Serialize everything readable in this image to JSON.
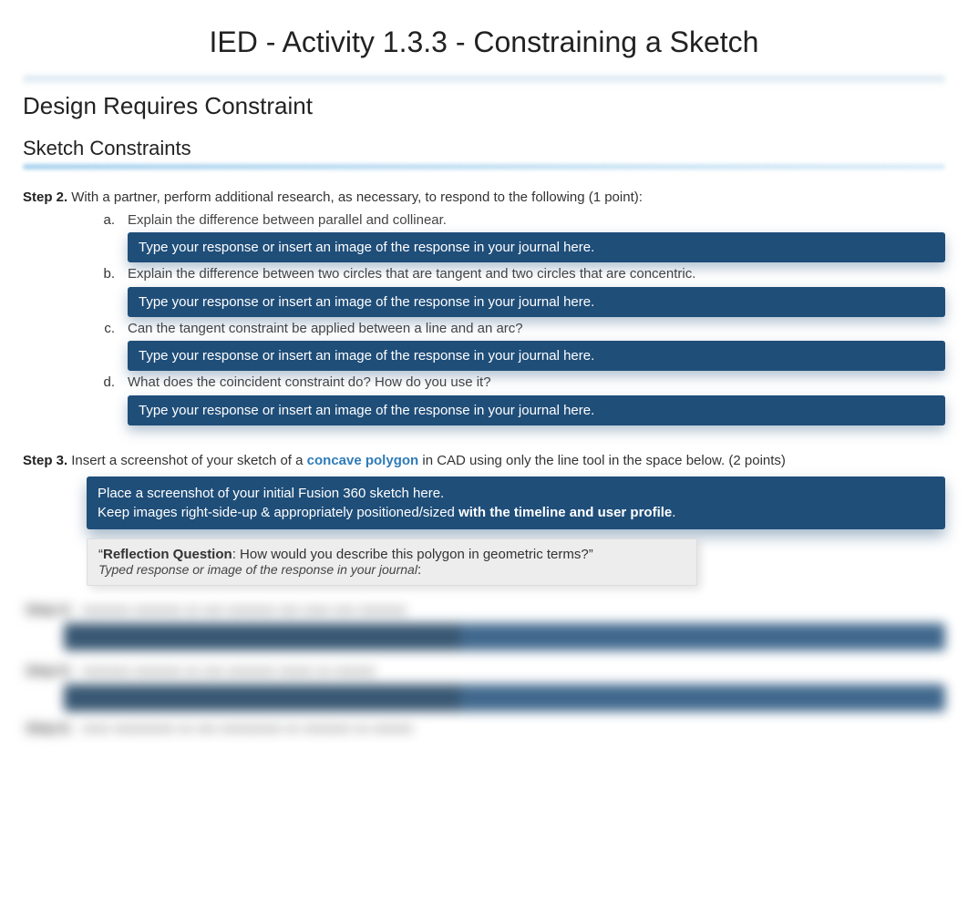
{
  "title": "IED - Activity 1.3.3 - Constraining a Sketch",
  "heading1": "Design Requires Constraint",
  "heading2": "Sketch Constraints",
  "step2": {
    "label": "Step 2.",
    "text": "With a partner, perform additional research, as necessary, to respond to the following (1 point):",
    "items": [
      {
        "marker": "a.",
        "text": "Explain the difference between parallel and collinear."
      },
      {
        "marker": "b.",
        "text": "Explain the difference between two circles that are tangent and two circles that are concentric."
      },
      {
        "marker": "c.",
        "text": "Can the tangent constraint be applied between a line and an arc?"
      },
      {
        "marker": "d.",
        "text": "What does the coincident constraint do? How do you use it?"
      }
    ],
    "response_placeholder": "Type your response or insert an image of the response in your journal here."
  },
  "step3": {
    "label": "Step 3.",
    "text_before": "Insert a screenshot of your sketch of a ",
    "link": "concave polygon",
    "text_after": " in CAD using only the line tool in the space below. (2 points)",
    "screenshot_line1": "Place a screenshot of your initial Fusion 360 sketch here.",
    "screenshot_line2a": "Keep images right-side-up & appropriately positioned/sized ",
    "screenshot_line2b": "with the timeline and user profile",
    "screenshot_line2c": ".",
    "reflection_quote_open": "“",
    "reflection_bold": "Reflection Question",
    "reflection_rest": ": How would you describe this polygon in geometric terms?”",
    "reflection_sub": "Typed response or image of the response in your journal",
    "reflection_colon": ":"
  }
}
